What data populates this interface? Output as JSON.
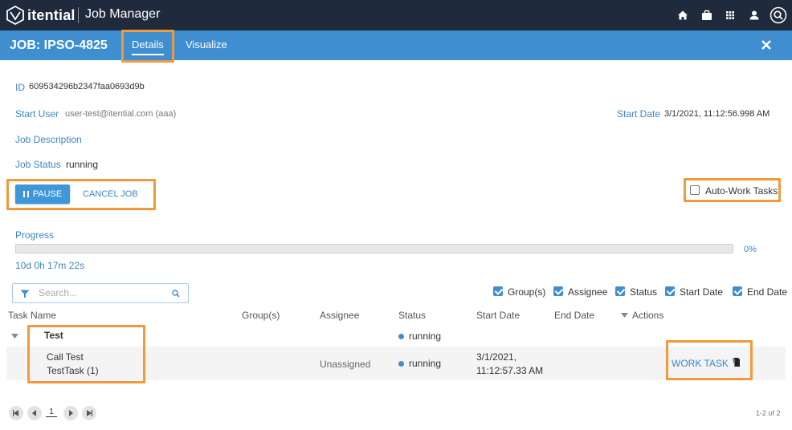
{
  "topbar": {
    "brand": "itential",
    "app_title": "Job Manager",
    "icons": [
      "home-icon",
      "briefcase-icon",
      "apps-grid-icon",
      "user-icon",
      "search-icon"
    ],
    "bg_color": "#1f2a3c"
  },
  "job": {
    "title": "JOB: IPSO-4825",
    "tabs": [
      {
        "label": "Details",
        "active": true
      },
      {
        "label": "Visualize",
        "active": false
      }
    ],
    "accent_color": "#3e8ed0"
  },
  "details": {
    "id_label": "ID",
    "id_value": "609534296b2347faa0693d9b",
    "start_user_label": "Start User",
    "start_user_value": "user-test@itential.com (aaa)",
    "start_date_label": "Start Date",
    "start_date_value": "3/1/2021, 11:12:56.998 AM",
    "description_label": "Job Description",
    "status_label": "Job Status",
    "status_value": "running"
  },
  "actions": {
    "pause_label": "PAUSE",
    "cancel_label": "CANCEL JOB",
    "auto_work_label": "Auto-Work Tasks",
    "auto_work_checked": false
  },
  "progress": {
    "label": "Progress",
    "percent_text": "0%",
    "percent": 0,
    "elapsed": "10d 0h 17m 22s"
  },
  "filters": {
    "search_placeholder": "Search...",
    "columns": [
      {
        "label": "Group(s)",
        "checked": true
      },
      {
        "label": "Assignee",
        "checked": true
      },
      {
        "label": "Status",
        "checked": true
      },
      {
        "label": "Start Date",
        "checked": true
      },
      {
        "label": "End Date",
        "checked": true
      }
    ]
  },
  "table": {
    "headers": {
      "task_name": "Task Name",
      "groups": "Group(s)",
      "assignee": "Assignee",
      "status": "Status",
      "start_date": "Start Date",
      "end_date": "End Date",
      "actions": "Actions"
    },
    "group_row": {
      "name": "Test",
      "status": "running"
    },
    "task_row": {
      "name_line1": "Call Test",
      "name_line2": "TestTask (1)",
      "assignee": "Unassigned",
      "status": "running",
      "start_line1": "3/1/2021,",
      "start_line2": "11:12:57.33 AM",
      "action_label": "WORK TASK"
    }
  },
  "pager": {
    "page": "1",
    "range": "1-2 of 2"
  },
  "highlight_color": "#f29a3b"
}
